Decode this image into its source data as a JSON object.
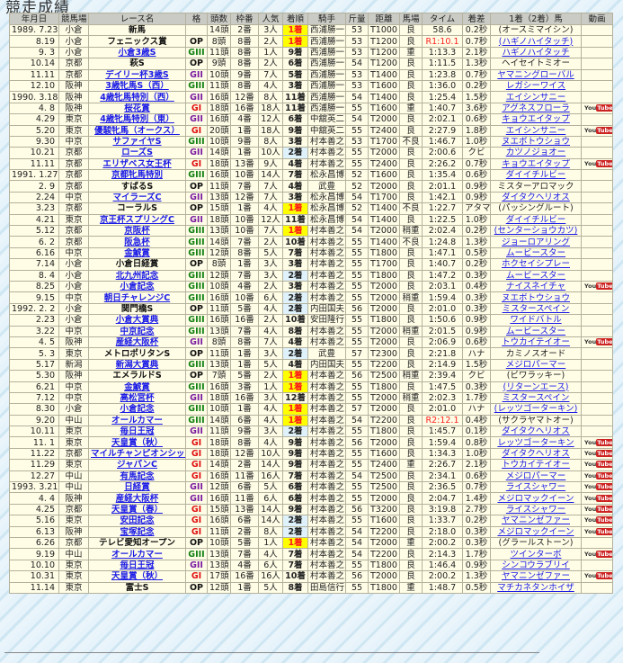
{
  "page_title": "競走成績",
  "video_icon_label": {
    "you": "You",
    "tube": "Tube"
  },
  "columns": [
    "年月日",
    "競馬場",
    "レース名",
    "格",
    "頭数",
    "枠番",
    "人気",
    "着順",
    "騎手",
    "斤量",
    "距離",
    "馬場",
    "タイム",
    "着差",
    "1着（2着）馬",
    "動画"
  ],
  "colors": {
    "first_bg": "#ffff00",
    "first_text": "#ff1a1a",
    "second_bg": "#dff2fb",
    "GI": "#e01010",
    "GII": "#7a1aa0",
    "GIII": "#108010",
    "link": "#1a1ae6"
  },
  "rows": [
    {
      "cells": [
        "1989. 7.23",
        "小倉",
        "新馬",
        "",
        "14頭",
        "2番",
        "3人",
        "1着",
        "西浦勝一",
        "53",
        "T1000",
        "良",
        "58.6",
        "0.2秒",
        "(オースミマイシン)"
      ],
      "race_link": false,
      "winner_link": false,
      "video": false
    },
    {
      "cells": [
        "8.19",
        "小倉",
        "フェニックス賞",
        "OP",
        "8頭",
        "8番",
        "2人",
        "1着",
        "西浦勝一",
        "53",
        "T1200",
        "良",
        "R1:10.1",
        "0.7秒",
        "(ハギノハイタッチ)"
      ],
      "race_link": false,
      "winner_link": true,
      "video": false
    },
    {
      "cells": [
        "9. 3",
        "小倉",
        "小倉3歳S",
        "GIII",
        "11頭",
        "8番",
        "1人",
        "9着",
        "西浦勝一",
        "53",
        "T1200",
        "重",
        "1:13.3",
        "2.1秒",
        "ハギノハイタッチ"
      ],
      "race_link": true,
      "winner_link": true,
      "video": false
    },
    {
      "cells": [
        "10.14",
        "京都",
        "萩S",
        "OP",
        "9頭",
        "8番",
        "2人",
        "6着",
        "西浦勝一",
        "54",
        "T1200",
        "良",
        "1:11.5",
        "1.3秒",
        "ヘイセイトミオー"
      ],
      "race_link": false,
      "winner_link": false,
      "video": false
    },
    {
      "cells": [
        "11.11",
        "京都",
        "デイリー杯3歳S",
        "GII",
        "10頭",
        "9番",
        "7人",
        "5着",
        "西浦勝一",
        "53",
        "T1400",
        "良",
        "1:23.8",
        "0.7秒",
        "ヤマニングローバル"
      ],
      "race_link": true,
      "winner_link": true,
      "video": false
    },
    {
      "cells": [
        "12.10",
        "阪神",
        "3歳牝馬S（西）",
        "GIII",
        "11頭",
        "8番",
        "4人",
        "3着",
        "西浦勝一",
        "53",
        "T1600",
        "良",
        "1:36.0",
        "0.2秒",
        "レガシーワイス"
      ],
      "race_link": true,
      "winner_link": true,
      "video": false
    },
    {
      "cells": [
        "1990. 3.18",
        "阪神",
        "4歳牝馬特別（西）",
        "GII",
        "16頭",
        "12番",
        "8人",
        "11着",
        "西浦勝一",
        "54",
        "T1400",
        "良",
        "1:25.4",
        "1.5秒",
        "エイシンサニー"
      ],
      "race_link": true,
      "winner_link": true,
      "video": false
    },
    {
      "cells": [
        "4. 8",
        "阪神",
        "桜花賞",
        "GI",
        "18頭",
        "16番",
        "18人",
        "11着",
        "西浦勝一",
        "55",
        "T1600",
        "重",
        "1:40.7",
        "3.6秒",
        "アグネスフローラ"
      ],
      "race_link": true,
      "winner_link": true,
      "video": true
    },
    {
      "cells": [
        "4.29",
        "東京",
        "4歳牝馬特別（東）",
        "GII",
        "16頭",
        "4番",
        "12人",
        "6着",
        "中舘英二",
        "54",
        "T2000",
        "良",
        "2:02.1",
        "0.6秒",
        "キョウエイタップ"
      ],
      "race_link": true,
      "winner_link": true,
      "video": false
    },
    {
      "cells": [
        "5.20",
        "東京",
        "優駿牝馬（オークス）",
        "GI",
        "20頭",
        "1番",
        "18人",
        "9着",
        "中舘英二",
        "55",
        "T2400",
        "良",
        "2:27.9",
        "1.8秒",
        "エイシンサニー"
      ],
      "race_link": true,
      "winner_link": true,
      "video": true
    },
    {
      "cells": [
        "9.30",
        "中京",
        "サファイヤS",
        "GIII",
        "10頭",
        "9番",
        "8人",
        "3着",
        "村本善之",
        "53",
        "T1700",
        "不良",
        "1:46.7",
        "1.0秒",
        "ヌエボトウショウ"
      ],
      "race_link": true,
      "winner_link": true,
      "video": false
    },
    {
      "cells": [
        "10.21",
        "京都",
        "ローズS",
        "GII",
        "14頭",
        "1番",
        "10人",
        "2着",
        "村本善之",
        "55",
        "T2000",
        "良",
        "2:00.6",
        "クビ",
        "カツノジョオー"
      ],
      "race_link": true,
      "winner_link": true,
      "video": false
    },
    {
      "cells": [
        "11.11",
        "京都",
        "エリザベス女王杯",
        "GI",
        "18頭",
        "13番",
        "9人",
        "4着",
        "村本善之",
        "55",
        "T2400",
        "良",
        "2:26.2",
        "0.7秒",
        "キョウエイタップ"
      ],
      "race_link": true,
      "winner_link": true,
      "video": true
    },
    {
      "cells": [
        "1991. 1.27",
        "京都",
        "京都牝馬特別",
        "GIII",
        "16頭",
        "10番",
        "14人",
        "7着",
        "松永昌博",
        "52",
        "T1600",
        "良",
        "1:35.4",
        "0.6秒",
        "ダイイチルビー"
      ],
      "race_link": true,
      "winner_link": true,
      "video": false
    },
    {
      "cells": [
        "2. 9",
        "京都",
        "すばるS",
        "OP",
        "11頭",
        "7番",
        "7人",
        "4着",
        "武豊",
        "52",
        "T2000",
        "良",
        "2:01.1",
        "0.9秒",
        "ミスターアロマック"
      ],
      "race_link": false,
      "winner_link": false,
      "video": false
    },
    {
      "cells": [
        "2.24",
        "中京",
        "マイラーズC",
        "GII",
        "13頭",
        "12番",
        "7人",
        "3着",
        "松永昌博",
        "54",
        "T1700",
        "良",
        "1:42.1",
        "0.9秒",
        "ダイタクヘリオス"
      ],
      "race_link": true,
      "winner_link": true,
      "video": false
    },
    {
      "cells": [
        "3.23",
        "京都",
        "コーラルS",
        "OP",
        "15頭",
        "1番",
        "4人",
        "1着",
        "松永昌博",
        "52",
        "T1400",
        "不良",
        "1:22.7",
        "アタマ",
        "(パッシングルート)"
      ],
      "race_link": false,
      "winner_link": false,
      "video": false
    },
    {
      "cells": [
        "4.21",
        "東京",
        "京王杯スプリングC",
        "GII",
        "18頭",
        "10番",
        "12人",
        "11着",
        "松永昌博",
        "54",
        "T1400",
        "良",
        "1:22.5",
        "1.0秒",
        "ダイイチルビー"
      ],
      "race_link": true,
      "winner_link": true,
      "video": false
    },
    {
      "cells": [
        "5.12",
        "京都",
        "京阪杯",
        "GIII",
        "13頭",
        "10番",
        "7人",
        "1着",
        "村本善之",
        "54",
        "T2000",
        "稍重",
        "2:02.4",
        "0.2秒",
        "(センターショウカツ)"
      ],
      "race_link": true,
      "winner_link": true,
      "video": false
    },
    {
      "cells": [
        "6. 2",
        "京都",
        "阪急杯",
        "GIII",
        "14頭",
        "7番",
        "2人",
        "10着",
        "村本善之",
        "55",
        "T1400",
        "不良",
        "1:24.8",
        "1.3秒",
        "ジョーロアリング"
      ],
      "race_link": true,
      "winner_link": true,
      "video": false
    },
    {
      "cells": [
        "6.16",
        "中京",
        "金鯱賞",
        "GIII",
        "12頭",
        "8番",
        "5人",
        "7着",
        "村本善之",
        "55",
        "T1800",
        "良",
        "1:47.1",
        "0.5秒",
        "ムービースター"
      ],
      "race_link": true,
      "winner_link": true,
      "video": false
    },
    {
      "cells": [
        "7.14",
        "小倉",
        "小倉日経賞",
        "OP",
        "8頭",
        "1番",
        "3人",
        "3着",
        "村本善之",
        "55",
        "T1700",
        "良",
        "1:40.7",
        "0.2秒",
        "ホクセイシプレー"
      ],
      "race_link": false,
      "winner_link": true,
      "video": false
    },
    {
      "cells": [
        "8. 4",
        "小倉",
        "北九州記念",
        "GIII",
        "12頭",
        "7番",
        "3人",
        "2着",
        "村本善之",
        "55",
        "T1800",
        "良",
        "1:47.2",
        "0.3秒",
        "ムービースター"
      ],
      "race_link": true,
      "winner_link": true,
      "video": false
    },
    {
      "cells": [
        "8.25",
        "小倉",
        "小倉記念",
        "GIII",
        "10頭",
        "4番",
        "2人",
        "3着",
        "村本善之",
        "55",
        "T2000",
        "良",
        "2:03.1",
        "0.4秒",
        "ナイスネイチャ"
      ],
      "race_link": true,
      "winner_link": true,
      "video": true
    },
    {
      "cells": [
        "9.15",
        "中京",
        "朝日チャレンジC",
        "GIII",
        "16頭",
        "10番",
        "6人",
        "2着",
        "村本善之",
        "55",
        "T2000",
        "稍重",
        "1:59.4",
        "0.3秒",
        "ヌエボトウショウ"
      ],
      "race_link": true,
      "winner_link": true,
      "video": false
    },
    {
      "cells": [
        "1992. 2. 2",
        "小倉",
        "関門橋S",
        "OP",
        "11頭",
        "5番",
        "4人",
        "2着",
        "内田国夫",
        "56",
        "T2000",
        "良",
        "2:01.0",
        "0.3秒",
        "ミスタースペイン"
      ],
      "race_link": false,
      "winner_link": true,
      "video": false
    },
    {
      "cells": [
        "2.23",
        "小倉",
        "小倉大賞典",
        "GIII",
        "16頭",
        "16番",
        "2人",
        "10着",
        "安田隆行",
        "55",
        "T1800",
        "良",
        "1:50.6",
        "0.9秒",
        "ワイドバトル"
      ],
      "race_link": true,
      "winner_link": true,
      "video": false
    },
    {
      "cells": [
        "3.22",
        "中京",
        "中京記念",
        "GIII",
        "13頭",
        "7番",
        "4人",
        "8着",
        "村本善之",
        "55",
        "T2000",
        "稍重",
        "2:01.5",
        "0.9秒",
        "ムービースター"
      ],
      "race_link": true,
      "winner_link": true,
      "video": false
    },
    {
      "cells": [
        "4. 5",
        "阪神",
        "産経大阪杯",
        "GII",
        "8頭",
        "8番",
        "7人",
        "4着",
        "村本善之",
        "55",
        "T2000",
        "良",
        "2:06.9",
        "0.6秒",
        "トウカイテイオー"
      ],
      "race_link": true,
      "winner_link": true,
      "video": true
    },
    {
      "cells": [
        "5. 3",
        "東京",
        "メトロポリタンS",
        "OP",
        "11頭",
        "1番",
        "3人",
        "2着",
        "武豊",
        "57",
        "T2300",
        "良",
        "2:21.8",
        "ハナ",
        "カミノスオード"
      ],
      "race_link": false,
      "winner_link": false,
      "video": false
    },
    {
      "cells": [
        "5.17",
        "新潟",
        "新潟大賞典",
        "GIII",
        "13頭",
        "1番",
        "5人",
        "4着",
        "内田国夫",
        "55",
        "T2200",
        "良",
        "2:14.9",
        "1.5秒",
        "メジロパーマー"
      ],
      "race_link": true,
      "winner_link": true,
      "video": false
    },
    {
      "cells": [
        "5.30",
        "阪神",
        "エメラルドS",
        "OP",
        "7頭",
        "5番",
        "2人",
        "1着",
        "村本善之",
        "56",
        "T2500",
        "稍重",
        "2:39.4",
        "クビ",
        "(ビワラッキー)"
      ],
      "race_link": false,
      "winner_link": false,
      "video": false
    },
    {
      "cells": [
        "6.21",
        "中京",
        "金鯱賞",
        "GIII",
        "16頭",
        "3番",
        "1人",
        "1着",
        "村本善之",
        "55",
        "T1800",
        "良",
        "1:47.5",
        "0.3秒",
        "(リターンエース)"
      ],
      "race_link": true,
      "winner_link": true,
      "video": false
    },
    {
      "cells": [
        "7.12",
        "中京",
        "高松宮杯",
        "GII",
        "18頭",
        "16番",
        "3人",
        "12着",
        "村本善之",
        "55",
        "T2000",
        "稍重",
        "2:02.3",
        "1.7秒",
        "ミスタースペイン"
      ],
      "race_link": true,
      "winner_link": true,
      "video": false
    },
    {
      "cells": [
        "8.30",
        "小倉",
        "小倉記念",
        "GIII",
        "10頭",
        "1番",
        "4人",
        "1着",
        "村本善之",
        "57",
        "T2000",
        "良",
        "2:01.0",
        "ハナ",
        "(レッツゴーターキン)"
      ],
      "race_link": true,
      "winner_link": true,
      "video": false
    },
    {
      "cells": [
        "9.20",
        "中山",
        "オールカマー",
        "GIII",
        "14頭",
        "6番",
        "4人",
        "1着",
        "村本善之",
        "54",
        "T2200",
        "良",
        "R2:12.1",
        "0.4秒",
        "(サクラヤマトオー)"
      ],
      "race_link": true,
      "winner_link": false,
      "video": false
    },
    {
      "cells": [
        "10.11",
        "東京",
        "毎日王冠",
        "GII",
        "11頭",
        "9番",
        "3人",
        "2着",
        "村本善之",
        "55",
        "T1800",
        "良",
        "1:45.7",
        "0.1秒",
        "ダイタクヘリオス"
      ],
      "race_link": true,
      "winner_link": true,
      "video": false
    },
    {
      "cells": [
        "11. 1",
        "東京",
        "天皇賞（秋）",
        "GI",
        "18頭",
        "8番",
        "4人",
        "9着",
        "村本善之",
        "56",
        "T2000",
        "良",
        "1:59.4",
        "0.8秒",
        "レッツゴーターキン"
      ],
      "race_link": true,
      "winner_link": true,
      "video": true
    },
    {
      "cells": [
        "11.22",
        "京都",
        "マイルチャンピオンシップ",
        "GI",
        "18頭",
        "12番",
        "10人",
        "9着",
        "村本善之",
        "55",
        "T1600",
        "良",
        "1:34.3",
        "1.0秒",
        "ダイタクヘリオス"
      ],
      "race_link": true,
      "winner_link": true,
      "video": true
    },
    {
      "cells": [
        "11.29",
        "東京",
        "ジャパンC",
        "GI",
        "14頭",
        "2番",
        "14人",
        "9着",
        "村本善之",
        "55",
        "T2400",
        "重",
        "2:26.7",
        "2.1秒",
        "トウカイテイオー"
      ],
      "race_link": true,
      "winner_link": true,
      "video": true
    },
    {
      "cells": [
        "12.27",
        "中山",
        "有馬記念",
        "GI",
        "16頭",
        "11番",
        "16人",
        "7着",
        "村本善之",
        "54",
        "T2500",
        "良",
        "2:34.1",
        "0.6秒",
        "メジロパーマー"
      ],
      "race_link": true,
      "winner_link": true,
      "video": true
    },
    {
      "cells": [
        "1993. 3.21",
        "中山",
        "日経賞",
        "GII",
        "12頭",
        "6番",
        "5人",
        "6着",
        "村本善之",
        "55",
        "T2500",
        "良",
        "2:36.5",
        "0.7秒",
        "ライスシャワー"
      ],
      "race_link": true,
      "winner_link": true,
      "video": true
    },
    {
      "cells": [
        "4. 4",
        "阪神",
        "産経大阪杯",
        "GII",
        "16頭",
        "11番",
        "6人",
        "6着",
        "村本善之",
        "55",
        "T2000",
        "良",
        "2:04.7",
        "1.4秒",
        "メジロマックイーン"
      ],
      "race_link": true,
      "winner_link": true,
      "video": true
    },
    {
      "cells": [
        "4.25",
        "京都",
        "天皇賞（春）",
        "GI",
        "15頭",
        "13番",
        "14人",
        "9着",
        "村本善之",
        "56",
        "T3200",
        "良",
        "3:19.8",
        "2.7秒",
        "ライスシャワー"
      ],
      "race_link": true,
      "winner_link": true,
      "video": true
    },
    {
      "cells": [
        "5.16",
        "東京",
        "安田記念",
        "GI",
        "16頭",
        "6番",
        "14人",
        "2着",
        "村本善之",
        "55",
        "T1600",
        "良",
        "1:33.7",
        "0.2秒",
        "ヤマニンゼファー"
      ],
      "race_link": true,
      "winner_link": true,
      "video": true
    },
    {
      "cells": [
        "6.13",
        "阪神",
        "宝塚記念",
        "GI",
        "11頭",
        "2番",
        "8人",
        "2着",
        "村本善之",
        "54",
        "T2200",
        "良",
        "2:18.0",
        "0.3秒",
        "メジロマックイーン"
      ],
      "race_link": true,
      "winner_link": true,
      "video": true
    },
    {
      "cells": [
        "6.26",
        "京都",
        "テレビ愛知オープン",
        "OP",
        "10頭",
        "5番",
        "1人",
        "1着",
        "村本善之",
        "54",
        "T2000",
        "重",
        "2:00.2",
        "0.3秒",
        "(グラールストーン)"
      ],
      "race_link": false,
      "winner_link": false,
      "video": false
    },
    {
      "cells": [
        "9.19",
        "中山",
        "オールカマー",
        "GIII",
        "13頭",
        "7番",
        "4人",
        "7着",
        "村本善之",
        "54",
        "T2200",
        "良",
        "2:14.3",
        "1.7秒",
        "ツインターボ"
      ],
      "race_link": true,
      "winner_link": true,
      "video": true
    },
    {
      "cells": [
        "10.10",
        "東京",
        "毎日王冠",
        "GII",
        "13頭",
        "4番",
        "6人",
        "7着",
        "村本善之",
        "55",
        "T1800",
        "良",
        "1:46.4",
        "0.9秒",
        "シンコウラブリイ"
      ],
      "race_link": true,
      "winner_link": true,
      "video": false
    },
    {
      "cells": [
        "10.31",
        "東京",
        "天皇賞（秋）",
        "GI",
        "17頭",
        "16番",
        "16人",
        "10着",
        "村本善之",
        "56",
        "T2000",
        "良",
        "2:00.2",
        "1.3秒",
        "ヤマニンゼファー"
      ],
      "race_link": true,
      "winner_link": true,
      "video": true
    },
    {
      "cells": [
        "11.14",
        "東京",
        "富士S",
        "OP",
        "12頭",
        "1番",
        "5人",
        "8着",
        "田島信行",
        "55",
        "T1800",
        "重",
        "1:48.7",
        "0.5秒",
        "マチカネタンホイザ"
      ],
      "race_link": false,
      "winner_link": true,
      "video": false
    }
  ]
}
